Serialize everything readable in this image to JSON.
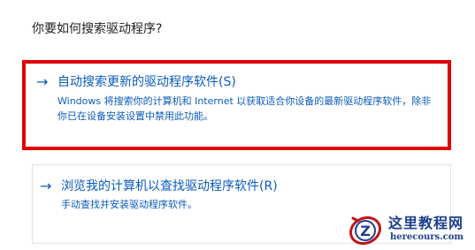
{
  "question": "你要如何搜索驱动程序?",
  "options": [
    {
      "arrow": "→",
      "title": "自动搜索更新的驱动程序软件(S)",
      "description": "Windows 将搜索你的计算机和 Internet 以获取适合你设备的最新驱动程序软件，除非你已在设备安装设置中禁用此功能。",
      "highlighted": true
    },
    {
      "arrow": "→",
      "title": "浏览我的计算机以查找驱动程序软件(R)",
      "description": "手动查找并安装驱动程序软件。",
      "highlighted": false
    }
  ],
  "watermark": {
    "logo_letter": "Z",
    "title": "这里教程网",
    "url": "herecours.com"
  },
  "colors": {
    "link_blue": "#0a5bbd",
    "highlight_red": "#e00000",
    "watermark_blue": "#1e3f8f"
  }
}
